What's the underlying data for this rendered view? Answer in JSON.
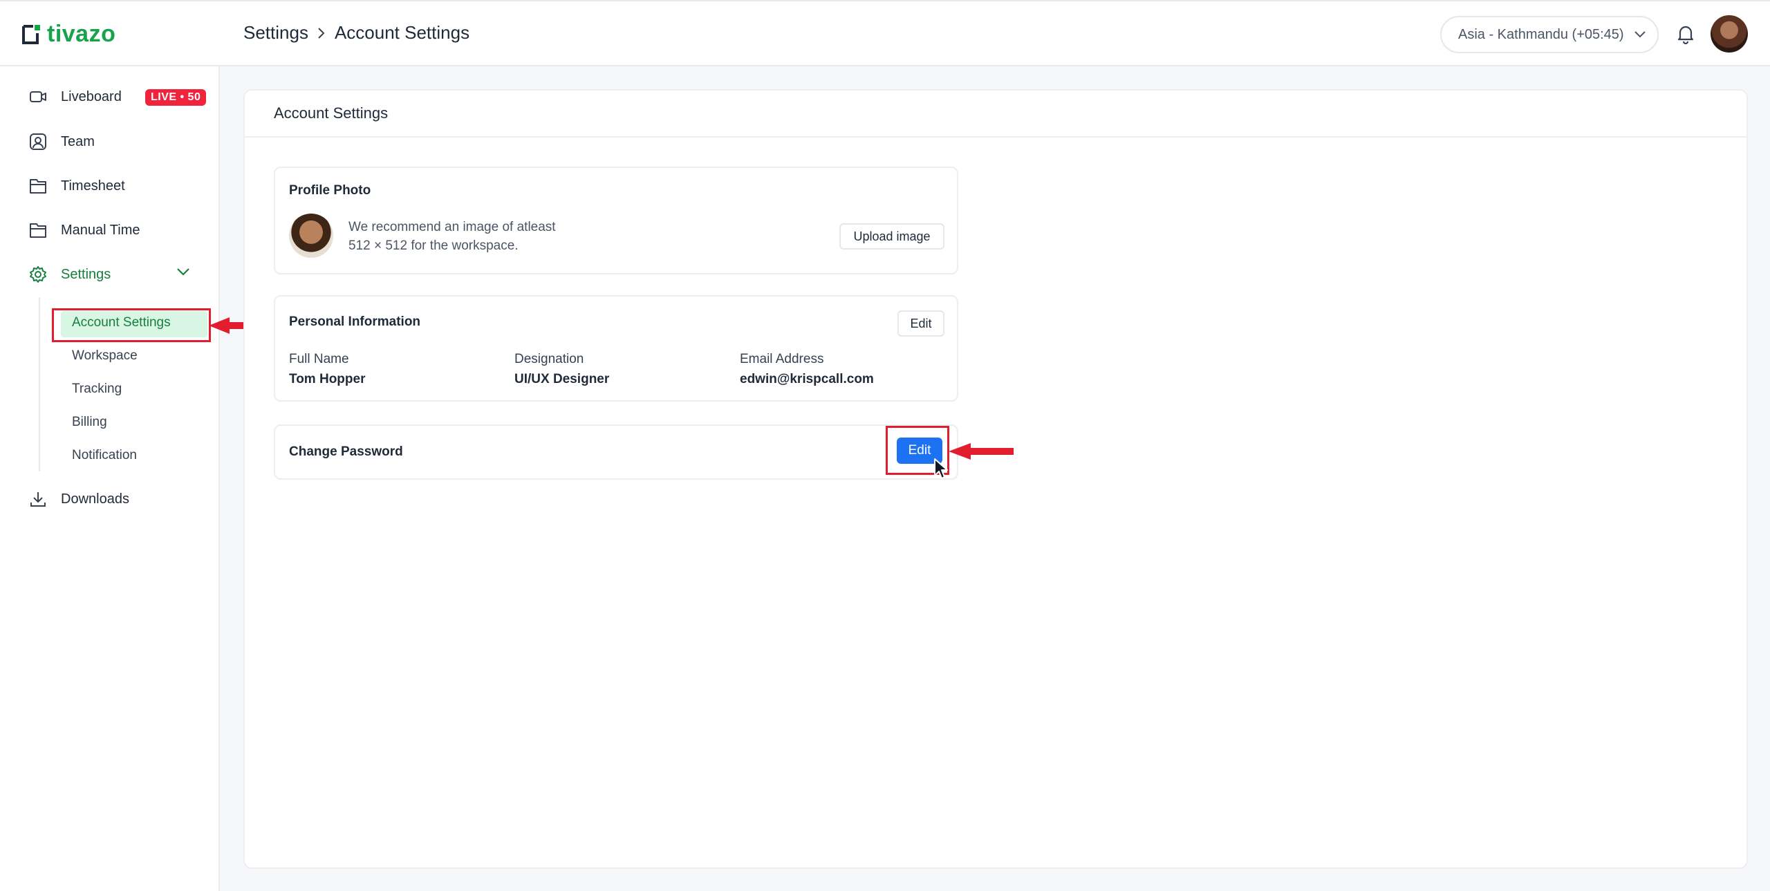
{
  "app": {
    "logo_text": "tivazo",
    "brand_color": "#16a34a"
  },
  "breadcrumb": {
    "items": [
      "Settings",
      "Account Settings"
    ]
  },
  "timezone": {
    "label": "Asia - Kathmandu (+05:45)"
  },
  "sidebar": {
    "items": [
      {
        "label": "Liveboard",
        "icon": "video-icon",
        "badge": "LIVE • 50"
      },
      {
        "label": "Team",
        "icon": "user-circle-icon"
      },
      {
        "label": "Timesheet",
        "icon": "timesheet-icon"
      },
      {
        "label": "Manual Time",
        "icon": "manual-time-icon"
      },
      {
        "label": "Settings",
        "icon": "gear-icon",
        "expanded": true
      },
      {
        "label": "Downloads",
        "icon": "download-icon"
      }
    ],
    "settings_sub": [
      "Account Settings",
      "Workspace",
      "Tracking",
      "Billing",
      "Notification"
    ],
    "active_sub": "Account Settings"
  },
  "page": {
    "title": "Account Settings",
    "profile_photo": {
      "title": "Profile Photo",
      "recommend_line1": "We recommend an image of atleast",
      "recommend_line2": "512 × 512 for the workspace.",
      "upload_label": "Upload image"
    },
    "personal_info": {
      "title": "Personal Information",
      "edit_label": "Edit",
      "fields": [
        {
          "label": "Full Name",
          "value": "Tom Hopper"
        },
        {
          "label": "Designation",
          "value": "UI/UX Designer"
        },
        {
          "label": "Email Address",
          "value": "edwin@krispcall.com"
        }
      ]
    },
    "change_password": {
      "title": "Change Password",
      "edit_label": "Edit"
    }
  },
  "colors": {
    "primary": "#1d72f3",
    "live": "#ef233c",
    "active_bg": "#d9f5e3",
    "annotation": "#e11d2e"
  }
}
